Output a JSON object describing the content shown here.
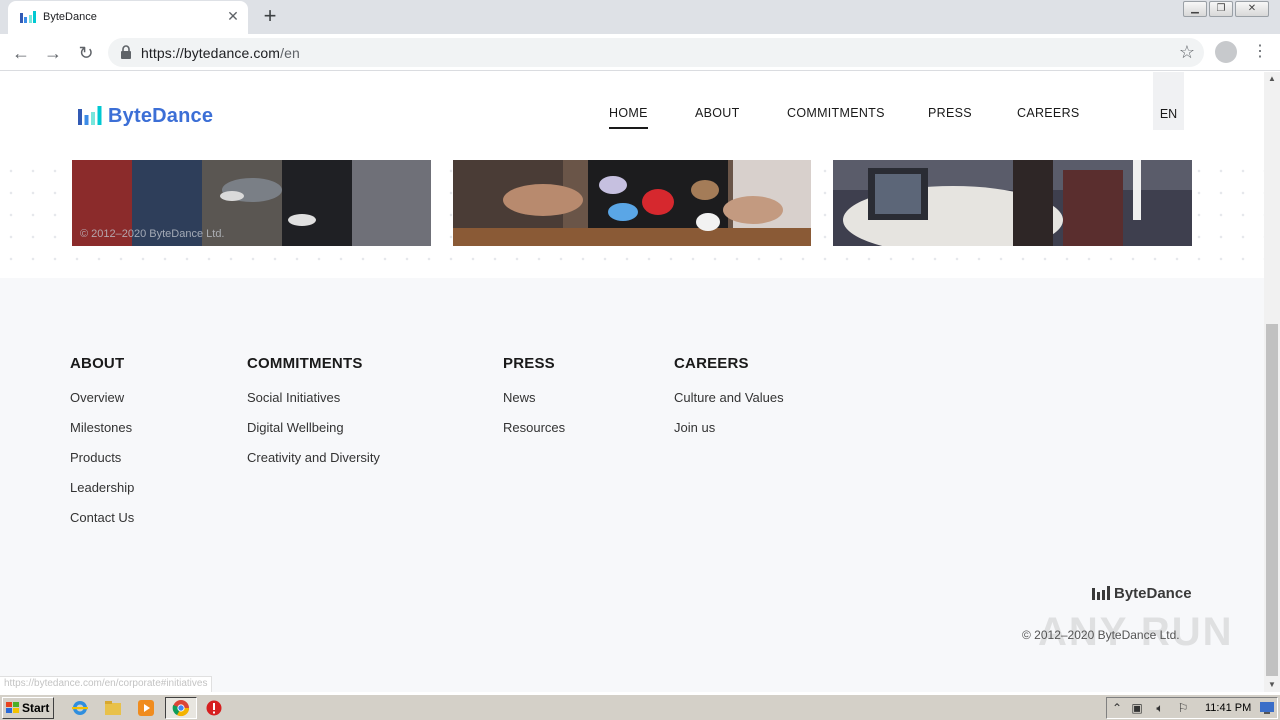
{
  "browser": {
    "tab_title": "ByteDance",
    "url_host": "https://bytedance.com",
    "url_path": "/en",
    "status_url": "https://bytedance.com/en/corporate#initiatives"
  },
  "header": {
    "logo_text": "ByteDance",
    "nav": [
      "HOME",
      "ABOUT",
      "COMMITMENTS",
      "PRESS",
      "CAREERS"
    ],
    "active_nav": "HOME",
    "language": "EN"
  },
  "photos": {
    "caption": "© 2012–2020 ByteDance Ltd."
  },
  "footer": {
    "columns": [
      {
        "heading": "ABOUT",
        "links": [
          "Overview",
          "Milestones",
          "Products",
          "Leadership",
          "Contact Us"
        ]
      },
      {
        "heading": "COMMITMENTS",
        "links": [
          "Social Initiatives",
          "Digital Wellbeing",
          "Creativity and Diversity"
        ]
      },
      {
        "heading": "PRESS",
        "links": [
          "News",
          "Resources"
        ]
      },
      {
        "heading": "CAREERS",
        "links": [
          "Culture and Values",
          "Join us"
        ]
      }
    ],
    "logo_text": "ByteDance",
    "copyright": "© 2012–2020 ByteDance Ltd."
  },
  "watermark": "ANY RUN",
  "taskbar": {
    "start_label": "Start",
    "clock": "11:41 PM"
  },
  "colors": {
    "brand_blue": "#3c6fd6",
    "footer_bg": "#f7f8fa"
  }
}
